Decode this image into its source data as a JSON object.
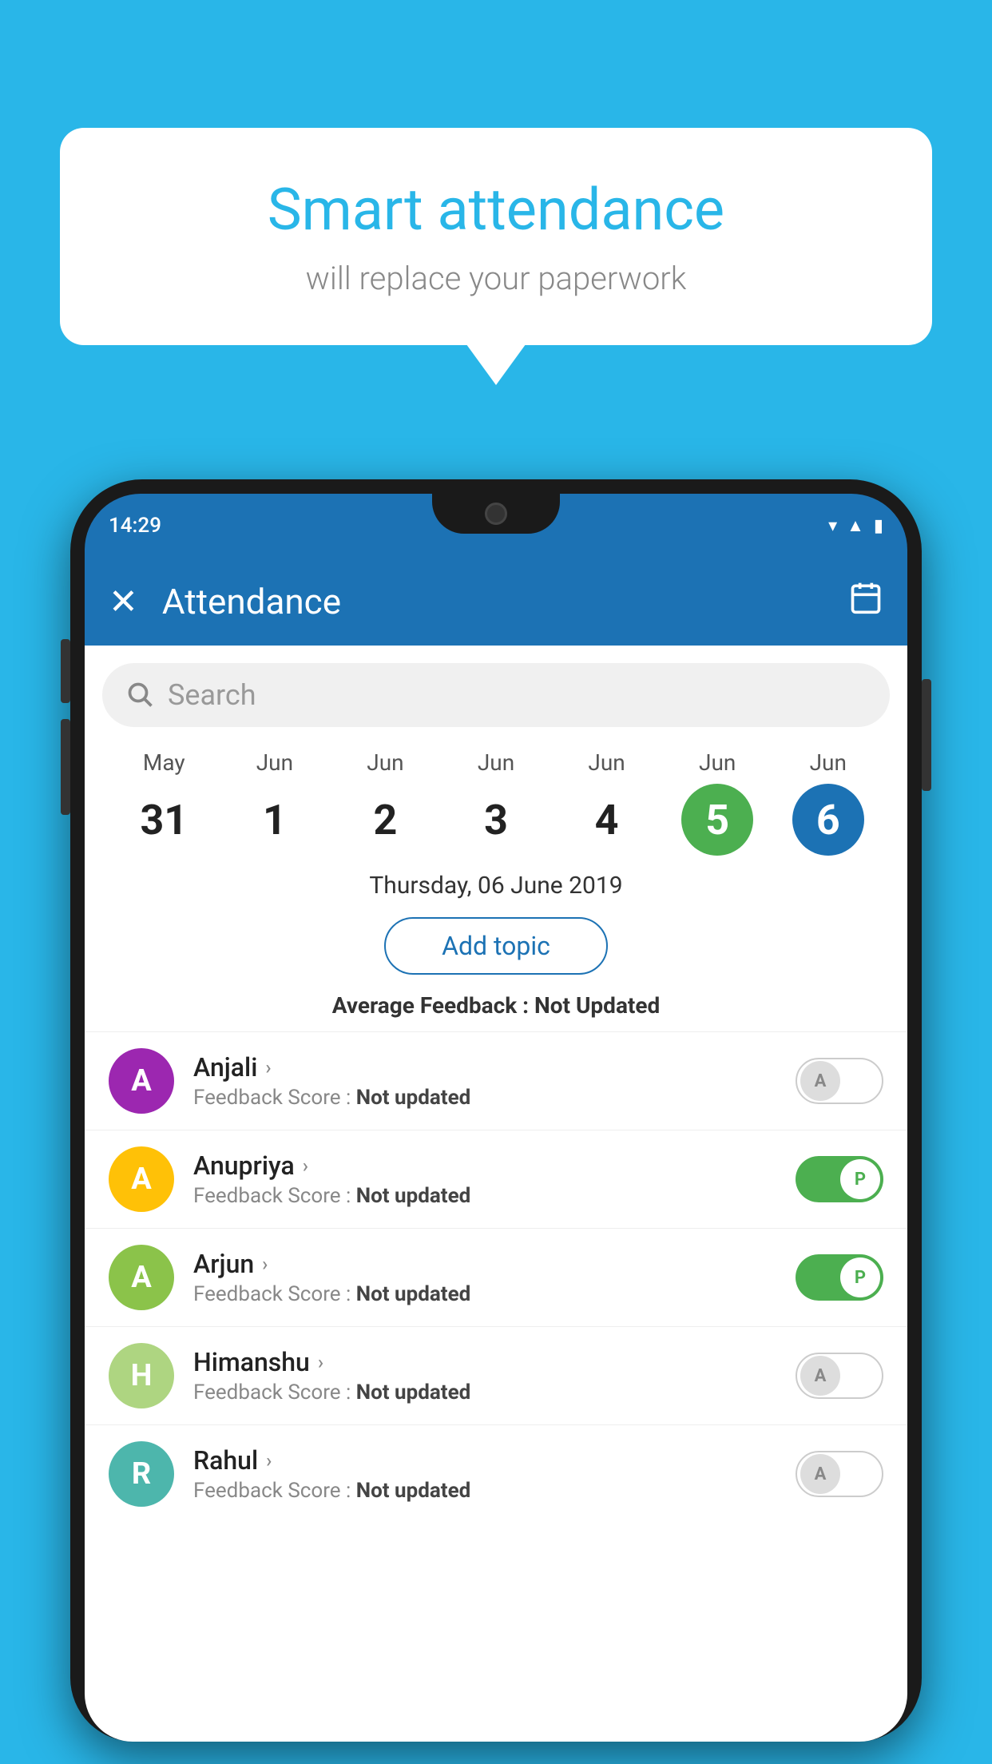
{
  "background_color": "#29b6e8",
  "bubble": {
    "title": "Smart attendance",
    "subtitle": "will replace your paperwork"
  },
  "phone": {
    "status_time": "14:29",
    "app_bar": {
      "title": "Attendance",
      "close_label": "✕",
      "calendar_icon": "📅"
    },
    "search": {
      "placeholder": "Search"
    },
    "calendar": {
      "days": [
        {
          "month": "May",
          "date": "31",
          "state": "normal"
        },
        {
          "month": "Jun",
          "date": "1",
          "state": "normal"
        },
        {
          "month": "Jun",
          "date": "2",
          "state": "normal"
        },
        {
          "month": "Jun",
          "date": "3",
          "state": "normal"
        },
        {
          "month": "Jun",
          "date": "4",
          "state": "normal"
        },
        {
          "month": "Jun",
          "date": "5",
          "state": "today"
        },
        {
          "month": "Jun",
          "date": "6",
          "state": "selected"
        }
      ]
    },
    "selected_date_label": "Thursday, 06 June 2019",
    "add_topic_label": "Add topic",
    "avg_feedback_label": "Average Feedback :",
    "avg_feedback_value": "Not Updated",
    "students": [
      {
        "name": "Anjali",
        "avatar_letter": "A",
        "avatar_color": "#9c27b0",
        "feedback_label": "Feedback Score :",
        "feedback_value": "Not updated",
        "attendance": "absent"
      },
      {
        "name": "Anupriya",
        "avatar_letter": "A",
        "avatar_color": "#ffc107",
        "feedback_label": "Feedback Score :",
        "feedback_value": "Not updated",
        "attendance": "present"
      },
      {
        "name": "Arjun",
        "avatar_letter": "A",
        "avatar_color": "#8bc34a",
        "feedback_label": "Feedback Score :",
        "feedback_value": "Not updated",
        "attendance": "present"
      },
      {
        "name": "Himanshu",
        "avatar_letter": "H",
        "avatar_color": "#aed581",
        "feedback_label": "Feedback Score :",
        "feedback_value": "Not updated",
        "attendance": "absent"
      },
      {
        "name": "Rahul",
        "avatar_letter": "R",
        "avatar_color": "#4db6ac",
        "feedback_label": "Feedback Score :",
        "feedback_value": "Not updated",
        "attendance": "partial"
      }
    ]
  }
}
